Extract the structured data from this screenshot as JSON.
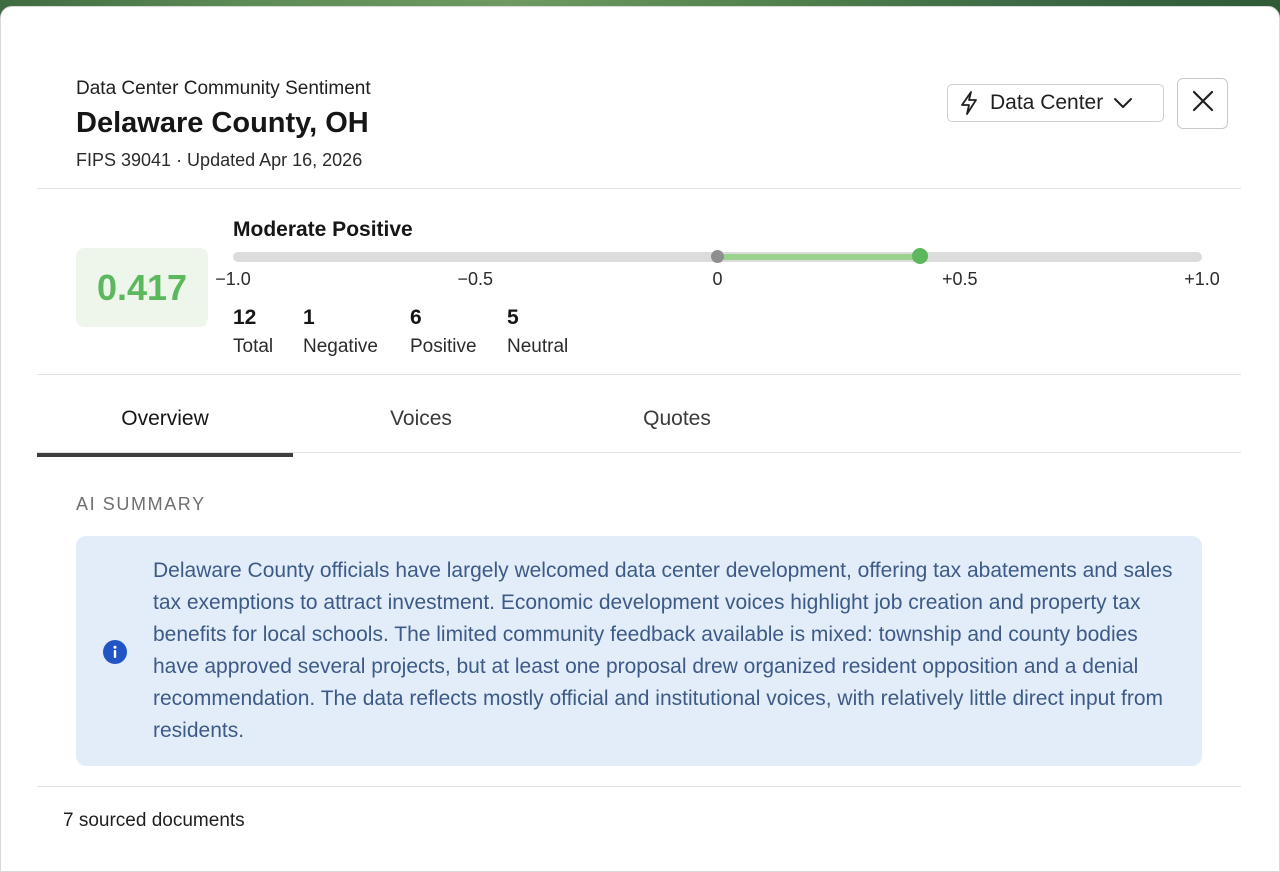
{
  "header": {
    "eyebrow": "Data Center Community Sentiment",
    "title": "Delaware County, OH",
    "meta": "FIPS 39041 · Updated Apr 16, 2026"
  },
  "controls": {
    "dataset_label": "Data Center",
    "dataset_icon": "lightning-icon",
    "close_icon": "close-icon"
  },
  "sentiment": {
    "score_text": "0.417",
    "score": 0.417,
    "level_label": "Moderate Positive",
    "scale_min": -1.0,
    "scale_max": 1.0,
    "ticks": [
      "−1.0",
      "−0.5",
      "0",
      "+0.5",
      "+1.0"
    ],
    "color": "#5cb85c"
  },
  "stats": [
    {
      "value": "12",
      "label": "Total"
    },
    {
      "value": "1",
      "label": "Negative"
    },
    {
      "value": "6",
      "label": "Positive"
    },
    {
      "value": "5",
      "label": "Neutral"
    }
  ],
  "tabs": [
    {
      "label": "Overview",
      "active": true
    },
    {
      "label": "Voices",
      "active": false
    },
    {
      "label": "Quotes",
      "active": false
    }
  ],
  "summary": {
    "heading": "AI SUMMARY",
    "text": "Delaware County officials have largely welcomed data center development, offering tax abatements and sales tax exemptions to attract investment. Economic development voices highlight job creation and property tax benefits for local schools. The limited community feedback available is mixed: township and county bodies have approved several projects, but at least one proposal drew organized resident opposition and a denial recommendation. The data reflects mostly official and institutional voices, with relatively little direct input from residents.",
    "icon": "info-icon"
  },
  "footer": {
    "text": "7 sourced documents"
  }
}
